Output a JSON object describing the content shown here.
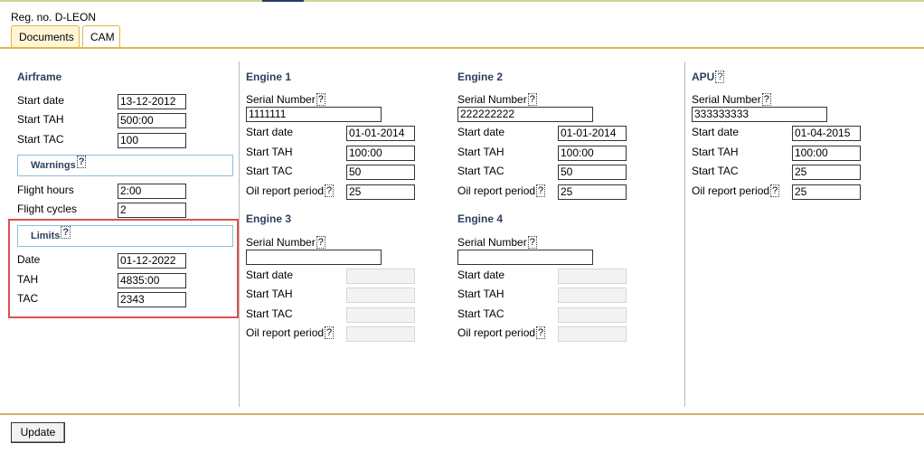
{
  "reg_no": "Reg. no. D-LEON",
  "tabs": [
    {
      "label": "Documents",
      "active": false
    },
    {
      "label": "CAM",
      "active": true
    }
  ],
  "help_glyph": "?",
  "airframe": {
    "title": "Airframe",
    "start_date_label": "Start date",
    "start_date": "13-12-2012",
    "start_tah_label": "Start TAH",
    "start_tah": "500:00",
    "start_tac_label": "Start TAC",
    "start_tac": "100",
    "warnings_title": "Warnings",
    "flight_hours_label": "Flight hours",
    "flight_hours": "2:00",
    "flight_cycles_label": "Flight cycles",
    "flight_cycles": "2",
    "limits_title": "Limits",
    "date_label": "Date",
    "date": "01-12-2022",
    "tah_label": "TAH",
    "tah": "4835:00",
    "tac_label": "TAC",
    "tac": "2343"
  },
  "engine1": {
    "title": "Engine 1",
    "serial_label": "Serial Number",
    "serial": "1111111",
    "start_date_label": "Start date",
    "start_date": "01-01-2014",
    "start_tah_label": "Start TAH",
    "start_tah": "100:00",
    "start_tac_label": "Start TAC",
    "start_tac": "50",
    "oil_label": "Oil report period",
    "oil": "25"
  },
  "engine2": {
    "title": "Engine 2",
    "serial_label": "Serial Number",
    "serial": "222222222",
    "start_date_label": "Start date",
    "start_date": "01-01-2014",
    "start_tah_label": "Start TAH",
    "start_tah": "100:00",
    "start_tac_label": "Start TAC",
    "start_tac": "50",
    "oil_label": "Oil report period",
    "oil": "25"
  },
  "engine3": {
    "title": "Engine 3",
    "serial_label": "Serial Number",
    "serial": "",
    "start_date_label": "Start date",
    "start_tah_label": "Start TAH",
    "start_tac_label": "Start TAC",
    "oil_label": "Oil report period"
  },
  "engine4": {
    "title": "Engine 4",
    "serial_label": "Serial Number",
    "serial": "",
    "start_date_label": "Start date",
    "start_tah_label": "Start TAH",
    "start_tac_label": "Start TAC",
    "oil_label": "Oil report period"
  },
  "apu": {
    "title": "APU",
    "serial_label": "Serial Number",
    "serial": "333333333",
    "start_date_label": "Start date",
    "start_date": "01-04-2015",
    "start_tah_label": "Start TAH",
    "start_tah": "100:00",
    "start_tac_label": "Start TAC",
    "start_tac": "25",
    "oil_label": "Oil report period",
    "oil": "25"
  },
  "update_label": "Update"
}
